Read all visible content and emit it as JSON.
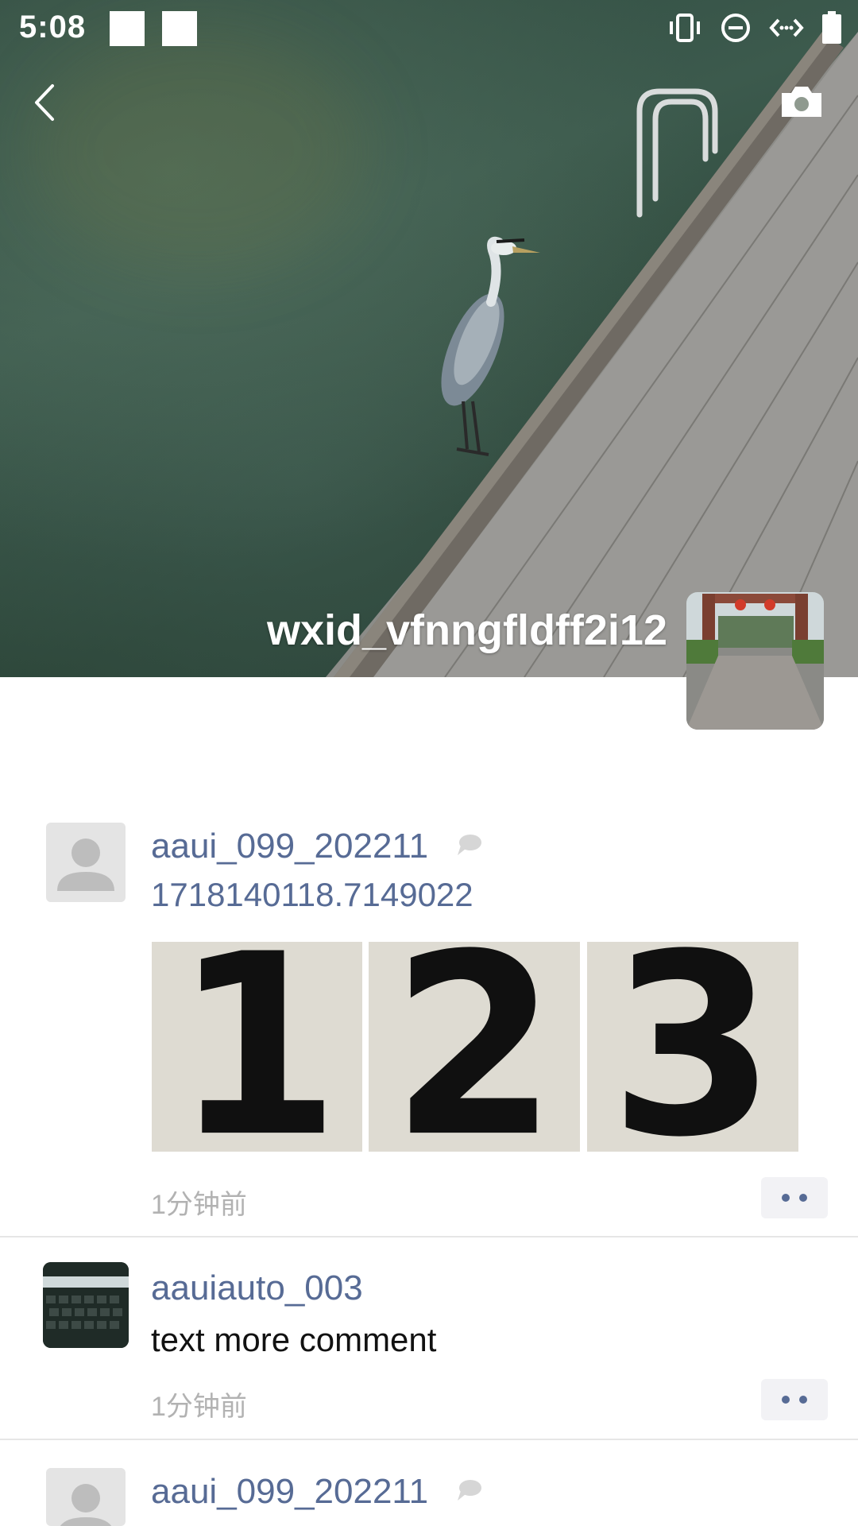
{
  "status_bar": {
    "time": "5:08"
  },
  "nav": {
    "back_icon": "chevron-left-icon",
    "camera_icon": "camera-icon"
  },
  "profile": {
    "name": "wxid_vfnngfldff2i12"
  },
  "posts": [
    {
      "user": "aaui_099_202211",
      "avatar": "default-avatar-icon",
      "text": "1718140118.7149022",
      "photos": [
        "1",
        "2",
        "3"
      ],
      "time": "1分钟前"
    },
    {
      "user": "aauiauto_003",
      "avatar": "keyboard-photo",
      "text": "text more comment",
      "time": "1分钟前"
    },
    {
      "user": "aaui_099_202211",
      "avatar": "default-avatar-icon"
    }
  ],
  "colors": {
    "link": "#576b95",
    "time": "#b2b2b2"
  }
}
